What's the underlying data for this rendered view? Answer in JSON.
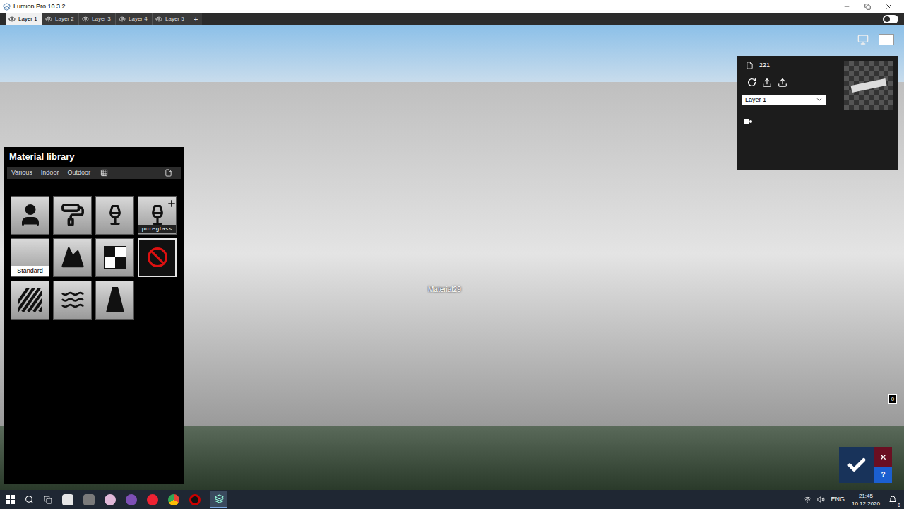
{
  "window": {
    "title": "Lumion Pro 10.3.2"
  },
  "layers": [
    {
      "label": "Layer 1",
      "selected": true
    },
    {
      "label": "Layer 2",
      "selected": false
    },
    {
      "label": "Layer 3",
      "selected": false
    },
    {
      "label": "Layer 4",
      "selected": false
    },
    {
      "label": "Layer 5",
      "selected": false
    }
  ],
  "add_layer": "+",
  "toggle": {
    "on": false
  },
  "viewport": {
    "hover_label": "Material29",
    "badge": "0"
  },
  "material_library": {
    "title": "Material library",
    "tabs": [
      {
        "label": "Various",
        "selected": false
      },
      {
        "label": "Indoor",
        "selected": false
      },
      {
        "label": "Outdoor",
        "selected": false
      }
    ],
    "tiles": [
      {
        "label": "",
        "selected": false
      },
      {
        "label": "",
        "selected": false
      },
      {
        "label": "",
        "selected": false
      },
      {
        "label": "pureglass",
        "selected": false
      },
      {
        "label": "Standard",
        "selected": false
      },
      {
        "label": "",
        "selected": false
      },
      {
        "label": "",
        "selected": false
      },
      {
        "label": "",
        "selected": true
      },
      {
        "label": "",
        "selected": false
      },
      {
        "label": "",
        "selected": false
      },
      {
        "label": "",
        "selected": false
      }
    ]
  },
  "properties_panel": {
    "count": "221",
    "layer_select": "Layer 1"
  },
  "help": "?",
  "taskbar": {
    "language": "ENG",
    "time": "21:45",
    "date": "10.12.2020",
    "notifications": "8"
  }
}
